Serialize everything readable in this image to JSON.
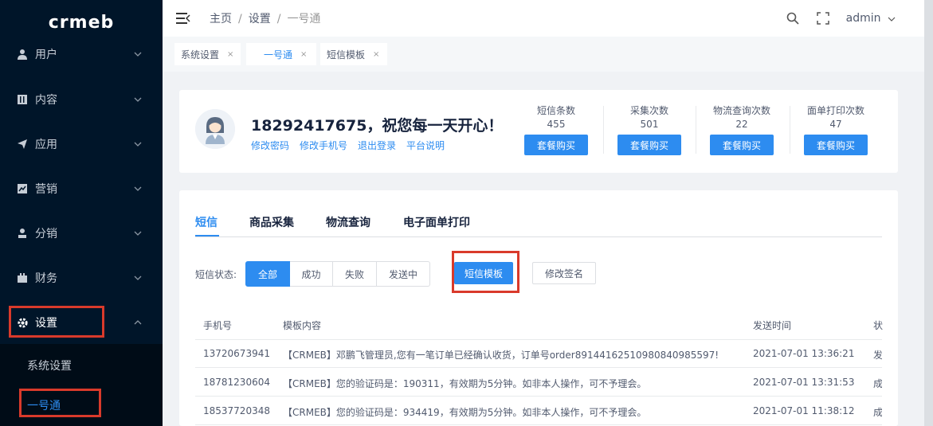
{
  "brand": "crmeb",
  "sidebar": {
    "items": [
      {
        "label": "用户",
        "icon": "user-icon"
      },
      {
        "label": "内容",
        "icon": "content-icon"
      },
      {
        "label": "应用",
        "icon": "send-icon"
      },
      {
        "label": "营销",
        "icon": "chart-icon"
      },
      {
        "label": "分销",
        "icon": "distribution-icon"
      },
      {
        "label": "财务",
        "icon": "finance-icon"
      },
      {
        "label": "设置",
        "icon": "gear-icon"
      }
    ],
    "sub_items": [
      {
        "label": "系统设置"
      },
      {
        "label": "一号通"
      }
    ]
  },
  "header": {
    "breadcrumb": [
      "主页",
      "设置",
      "一号通"
    ],
    "user": "admin"
  },
  "tabs": [
    {
      "label": "系统设置"
    },
    {
      "label": "一号通"
    },
    {
      "label": "短信模板"
    }
  ],
  "account": {
    "title": "18292417675，祝您每一天开心！",
    "links": [
      "修改密码",
      "修改手机号",
      "退出登录",
      "平台说明"
    ],
    "stats": [
      {
        "label": "短信条数",
        "value": "455",
        "button": "套餐购买"
      },
      {
        "label": "采集次数",
        "value": "501",
        "button": "套餐购买"
      },
      {
        "label": "物流查询次数",
        "value": "22",
        "button": "套餐购买"
      },
      {
        "label": "面单打印次数",
        "value": "47",
        "button": "套餐购买"
      }
    ]
  },
  "main": {
    "tabs": [
      "短信",
      "商品采集",
      "物流查询",
      "电子面单打印"
    ],
    "filter_label": "短信状态:",
    "filter_options": [
      "全部",
      "成功",
      "失败",
      "发送中"
    ],
    "template_button": "短信模板",
    "sign_button": "修改签名",
    "table": {
      "headers": [
        "手机号",
        "模板内容",
        "发送时间",
        "状"
      ],
      "rows": [
        {
          "phone": "13720673941",
          "content": "【CRMEB】邓鹏飞管理员,您有一笔订单已经确认收货，订单号order89144162510980840985597!",
          "time": "2021-07-01 13:36:21",
          "status": "发"
        },
        {
          "phone": "18781230604",
          "content": "【CRMEB】您的验证码是：190311，有效期为5分钟。如非本人操作，可不予理会。",
          "time": "2021-07-01 13:31:53",
          "status": "成"
        },
        {
          "phone": "18537720348",
          "content": "【CRMEB】您的验证码是：934419，有效期为5分钟。如非本人操作，可不予理会。",
          "time": "2021-07-01 11:38:12",
          "status": "成"
        }
      ]
    }
  },
  "colors": {
    "accent": "#2d8cf0",
    "sidebar_bg": "#001529",
    "highlight_box": "#d93a2b"
  }
}
